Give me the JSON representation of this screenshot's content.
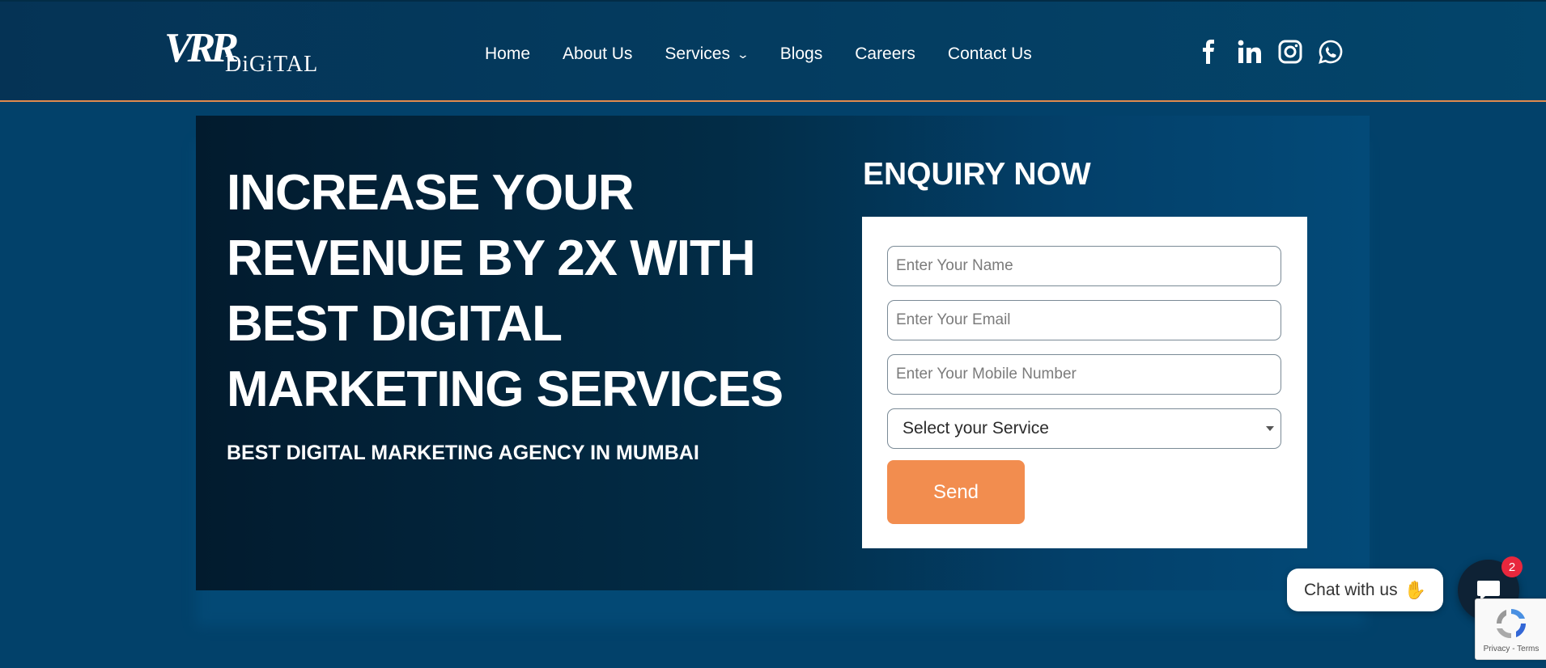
{
  "logo": {
    "main": "VRR",
    "sub": "DiGiTAL"
  },
  "nav": {
    "items": [
      {
        "label": "Home"
      },
      {
        "label": "About Us"
      },
      {
        "label": "Services",
        "dropdown": true
      },
      {
        "label": "Blogs"
      },
      {
        "label": "Careers"
      },
      {
        "label": "Contact Us"
      }
    ]
  },
  "social": [
    "facebook-icon",
    "linkedin-icon",
    "instagram-icon",
    "whatsapp-icon"
  ],
  "hero": {
    "headline": "INCREASE YOUR REVENUE BY 2X WITH BEST DIGITAL MARKETING SERVICES",
    "subheadline": "BEST DIGITAL MARKETING AGENCY IN MUMBAI"
  },
  "enquiry": {
    "title": "ENQUIRY NOW",
    "name_placeholder": "Enter Your Name",
    "email_placeholder": "Enter Your Email",
    "mobile_placeholder": "Enter Your Mobile Number",
    "service_select": "Select your Service",
    "send_label": "Send"
  },
  "chat": {
    "label": "Chat with us",
    "badge_count": "2"
  },
  "recaptcha": {
    "terms": "Privacy - Terms"
  },
  "colors": {
    "header_bg": "#053355",
    "page_bg": "#02416a",
    "accent_orange": "#f28d4f",
    "badge_red": "#e8273d"
  }
}
